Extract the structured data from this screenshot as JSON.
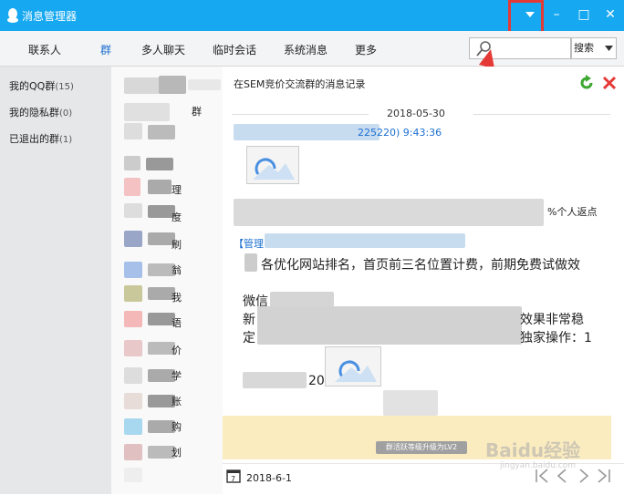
{
  "window": {
    "title": "消息管理器",
    "controls": {
      "minimize": "–",
      "maximize": "□",
      "close": "✕"
    }
  },
  "nav": {
    "tabs": [
      "联系人",
      "群",
      "多人聊天",
      "临时会话",
      "系统消息",
      "更多"
    ],
    "active": "群"
  },
  "search": {
    "placeholder": "",
    "button_label": "搜索"
  },
  "sidebar": {
    "items": [
      {
        "label": "我的QQ群",
        "count": "(15)"
      },
      {
        "label": "我的隐私群",
        "count": "(0)"
      },
      {
        "label": "已退出的群",
        "count": "(1)"
      }
    ]
  },
  "group_list_partial": {
    "fragments": [
      "群",
      "理",
      "度",
      "刷",
      "翁",
      "我",
      "语",
      "价",
      "学",
      "账",
      "购",
      "划"
    ]
  },
  "chat": {
    "header_title": "在SEM竞价交流群的消息记录",
    "date_separator": "2018-05-30",
    "message_time": "225220) 9:43:36",
    "snippet_rebate": "%个人返点",
    "sender_label": "【管理",
    "line1": "各优化网站排名，首页前三名位置计费，前期免费试做效",
    "line2": "微信",
    "line3a": "新",
    "line3b": "效果非常稳",
    "line4a": "定",
    "line4b": "独家操作：1",
    "line5": "20",
    "notice_text": "群活跃等级升级为LV2"
  },
  "footer": {
    "date": "2018-6-1",
    "watermark": "Baidu经验",
    "watermark_url": "jingyan.baidu.com"
  },
  "colors": {
    "titlebar": "#16a8f0",
    "accent": "#1c6fd1",
    "highlight": "#e53935",
    "banner": "#fbecc0"
  },
  "icons": [
    "qq-penguin-icon",
    "dropdown-icon",
    "minimize-icon",
    "maximize-icon",
    "close-icon",
    "search-icon",
    "refresh-icon",
    "delete-icon",
    "calendar-icon",
    "nav-first-icon",
    "nav-prev-icon",
    "nav-next-icon",
    "nav-last-icon",
    "image-thumbnail-icon"
  ]
}
